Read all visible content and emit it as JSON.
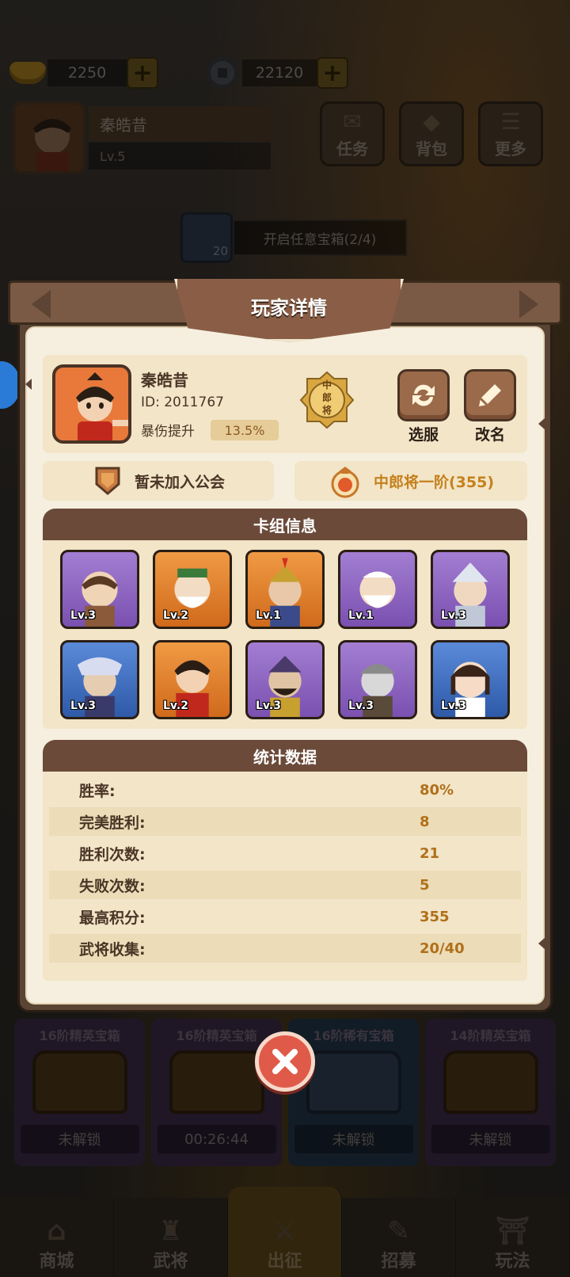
{
  "hud": {
    "gold": "2250",
    "coins": "22120",
    "player_name": "秦皓昔",
    "player_level": "Lv.5",
    "buttons": [
      {
        "label": "任务",
        "icon": "scroll-icon"
      },
      {
        "label": "背包",
        "icon": "bag-icon"
      },
      {
        "label": "更多",
        "icon": "menu-icon"
      }
    ],
    "quest": {
      "card_count": "20",
      "text": "开启任意宝箱(2/4)"
    }
  },
  "chests": [
    {
      "title": "16阶精英宝箱",
      "status": "未解锁",
      "color": "purple"
    },
    {
      "title": "16阶精英宝箱",
      "status": "00:26:44",
      "color": "purple"
    },
    {
      "title": "16阶稀有宝箱",
      "status": "未解锁",
      "color": "blue"
    },
    {
      "title": "14阶精英宝箱",
      "status": "未解锁",
      "color": "purple"
    }
  ],
  "bottom_nav": [
    {
      "label": "商城",
      "active": false
    },
    {
      "label": "武将",
      "active": false
    },
    {
      "label": "出征",
      "active": true
    },
    {
      "label": "招募",
      "active": false
    },
    {
      "label": "玩法",
      "active": false
    }
  ],
  "modal": {
    "title": "玩家详情",
    "player": {
      "name": "秦皓昔",
      "id": "ID: 2011767",
      "crit_label": "暴伤提升",
      "crit_value": "13.5%",
      "medal_text": "中郎将"
    },
    "actions": {
      "server": "选服",
      "rename": "改名"
    },
    "guild": "暂未加入公会",
    "rank": "中郎将一阶(355)",
    "deck_title": "卡组信息",
    "deck": [
      {
        "level": "Lv.3",
        "color": "purple"
      },
      {
        "level": "Lv.2",
        "color": "orange"
      },
      {
        "level": "Lv.1",
        "color": "orange"
      },
      {
        "level": "Lv.1",
        "color": "purple"
      },
      {
        "level": "Lv.3",
        "color": "purple"
      },
      {
        "level": "Lv.3",
        "color": "blue"
      },
      {
        "level": "Lv.2",
        "color": "orange"
      },
      {
        "level": "Lv.3",
        "color": "purple"
      },
      {
        "level": "Lv.3",
        "color": "purple"
      },
      {
        "level": "Lv.3",
        "color": "blue"
      }
    ],
    "stats_title": "统计数据",
    "stats": [
      {
        "label": "胜率:",
        "value": "80%"
      },
      {
        "label": "完美胜利:",
        "value": "8"
      },
      {
        "label": "胜利次数:",
        "value": "21"
      },
      {
        "label": "失败次数:",
        "value": "5"
      },
      {
        "label": "最高积分:",
        "value": "355"
      },
      {
        "label": "武将收集:",
        "value": "20/40"
      }
    ]
  },
  "colors": {
    "panel": "#f6efdf",
    "section_header": "#6b4a3a",
    "stat_value": "#b0701a",
    "rank_text": "#c5811d",
    "close_button": "#e05a4a"
  }
}
